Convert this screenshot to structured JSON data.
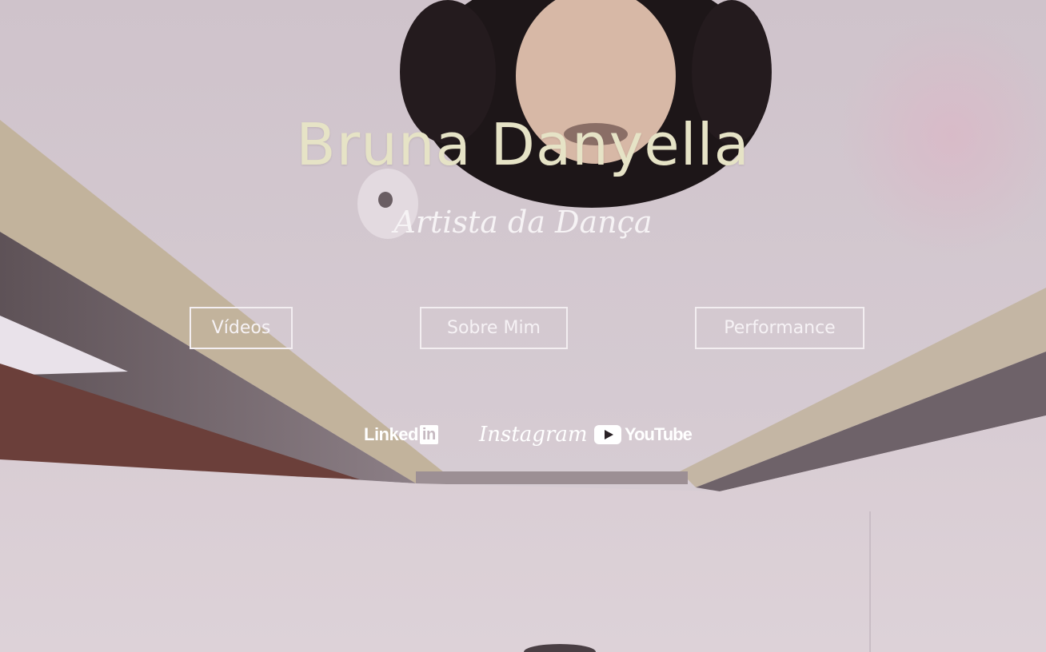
{
  "hero": {
    "title": "Bruna Danyella",
    "subtitle": "Artista da Dança"
  },
  "nav": {
    "videos_label": "Vídeos",
    "about_label": "Sobre Mim",
    "performance_label": "Performance"
  },
  "social": {
    "linkedin_text": "Linked",
    "linkedin_box": "in",
    "instagram_label": "Instagram",
    "youtube_label": "YouTube"
  },
  "colors": {
    "title": "#e6e3c6",
    "text": "#f6f2f5",
    "background": "#cbbfc7"
  }
}
